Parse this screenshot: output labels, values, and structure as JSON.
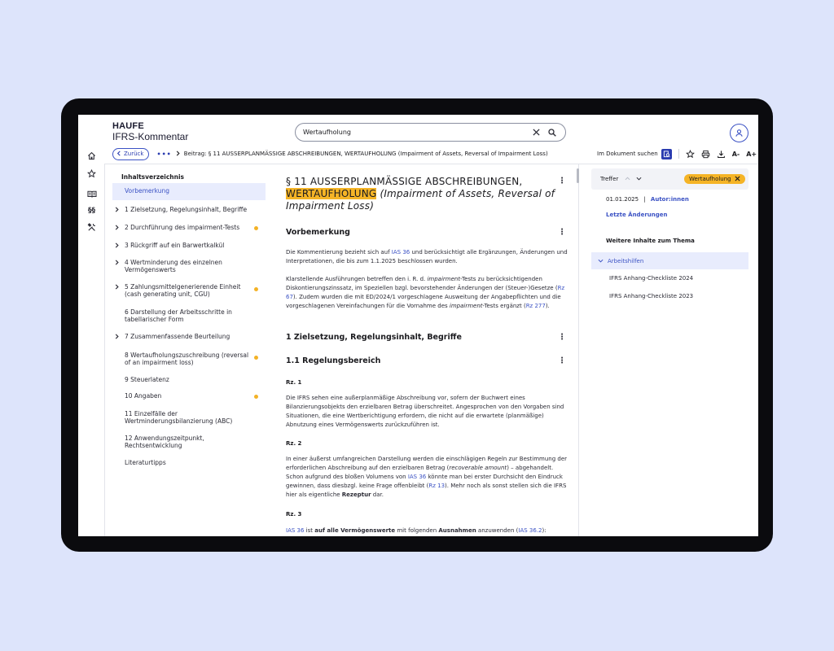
{
  "brand": {
    "logo": "HAUFE",
    "product": "IFRS-Kommentar"
  },
  "search": {
    "value": "Wertaufholung",
    "placeholder": ""
  },
  "breadcrumb": {
    "back_label": "Zurück",
    "ellipsis": "•••",
    "current": "Beitrag: § 11 AUSSERPLANMÄSSIGE ABSCHREIBUNGEN, WERTAUFHOLUNG (Impairment of Assets, Reversal of Impairment Loss)"
  },
  "doc_tools": {
    "in_doc_search_label": "Im Dokument suchen",
    "font_smaller": "A-",
    "font_larger": "A+"
  },
  "toc": {
    "title": "Inhaltsverzeichnis",
    "items": [
      {
        "label": "Vorbemerkung",
        "active": true,
        "expandable": false,
        "dot": false
      },
      {
        "label": "1 Zielsetzung, Regelungsinhalt, Begriffe",
        "active": false,
        "expandable": true,
        "dot": false
      },
      {
        "label": "2 Durchführung des impairment-Tests",
        "active": false,
        "expandable": true,
        "dot": true
      },
      {
        "label": "3 Rückgriff auf ein Barwertkalkül",
        "active": false,
        "expandable": true,
        "dot": false
      },
      {
        "label": "4 Wertminderung des einzelnen Vermögenswerts",
        "active": false,
        "expandable": true,
        "dot": false
      },
      {
        "label": "5 Zahlungsmittelgenerierende Einheit (cash generating unit, CGU)",
        "active": false,
        "expandable": true,
        "dot": true
      },
      {
        "label": "6 Darstellung der Arbeitsschritte in tabellarischer Form",
        "active": false,
        "expandable": false,
        "dot": false
      },
      {
        "label": "7 Zusammenfassende Beurteilung",
        "active": false,
        "expandable": true,
        "dot": false
      },
      {
        "label": "8 Wertaufholungszuschreibung (reversal of an impairment loss)",
        "active": false,
        "expandable": false,
        "dot": true
      },
      {
        "label": "9 Steuerlatenz",
        "active": false,
        "expandable": false,
        "dot": false
      },
      {
        "label": "10 Angaben",
        "active": false,
        "expandable": false,
        "dot": true
      },
      {
        "label": "11 Einzelfälle der Wertminderungsbilanzierung (ABC)",
        "active": false,
        "expandable": false,
        "dot": false
      },
      {
        "label": "12 Anwendungszeitpunkt, Rechtsentwicklung",
        "active": false,
        "expandable": false,
        "dot": false
      },
      {
        "label": "Literaturtipps",
        "active": false,
        "expandable": false,
        "dot": false
      }
    ]
  },
  "article": {
    "title_part1": "§ 11 AUSSERPLANMÄSSIGE ABSCHREIBUNGEN,",
    "title_highlight": "WERTAUFHOLUNG",
    "title_italic": "(Impairment of Assets, Reversal of Impairment Loss)",
    "section_vorbemerkung": "Vorbemerkung",
    "vb_p1_a": "Die Kommentierung bezieht sich auf ",
    "vb_p1_link": "IAS 36",
    "vb_p1_b": " und berücksichtigt alle Ergänzungen, Änderungen und Interpretationen, die bis zum 1.1.2025 beschlossen wurden.",
    "vb_p2_a": "Klarstellende Ausführungen betreffen den i. R. d. ",
    "vb_p2_i1": "impairment",
    "vb_p2_b": "-Tests zu berücksichtigenden Diskontierungszinssatz, im Speziellen bzgl. bevorstehender Änderungen der (Steuer-)Gesetze (",
    "vb_p2_link1": "Rz 67",
    "vb_p2_c": "). Zudem wurden die mit ED/2024/1 vorgeschlagene Ausweitung der Angabepflichten und die vorgeschlagenen Vereinfachungen für die Vornahme des ",
    "vb_p2_i2": "impairment",
    "vb_p2_d": "-Tests ergänzt (",
    "vb_p2_link2": "Rz 277",
    "vb_p2_e": ").",
    "section_1": "1 Zielsetzung, Regelungsinhalt, Begriffe",
    "section_1_1": "1.1 Regelungsbereich",
    "rz1": "Rz. 1",
    "rz1_text": "Die IFRS sehen eine außerplanmäßige Abschreibung vor, sofern der Buchwert eines Bilanzierungsobjekts den erzielbaren Betrag überschreitet. Angesprochen von den Vorgaben sind Situationen, die eine Wertberichtigung erfordern, die nicht auf die erwartete (planmäßige) Abnutzung eines Vermögenswerts zurückzuführen ist.",
    "rz2": "Rz. 2",
    "rz2_a": "In einer äußerst umfangreichen Darstellung werden die einschlägigen Regeln zur Bestimmung der erforderlichen Abschreibung auf den erzielbaren Betrag (",
    "rz2_i": "recoverable amount",
    "rz2_b": ") – abgehandelt. Schon aufgrund des bloßen Volumens von ",
    "rz2_link1": "IAS 36",
    "rz2_c": " könnte man bei erster Durchsicht den Eindruck gewinnen, dass diesbzgl. keine Frage offenbleibt (",
    "rz2_link2": "Rz 13",
    "rz2_d": "). Mehr noch als sonst stellen sich die IFRS hier als eigentliche ",
    "rz2_bold": "Rezeptur",
    "rz2_e": " dar.",
    "rz3": "Rz. 3",
    "rz3_link1": "IAS 36",
    "rz3_a": " ist ",
    "rz3_bold1": "auf alle Vermögenswerte",
    "rz3_b": " mit folgenden ",
    "rz3_bold2": "Ausnahmen",
    "rz3_c": " anzuwenden (",
    "rz3_link2": "IAS 36.2",
    "rz3_d": "):"
  },
  "panel": {
    "treffer_label": "Treffer",
    "chip_label": "Wertaufholung",
    "date": "01.01.2025",
    "date_sep": "|",
    "authors_link": "Autor:innen",
    "last_changes": "Letzte Änderungen",
    "more_title": "Weitere Inhalte zum Thema",
    "group_label": "Arbeitshilfen",
    "group_items": [
      "IFRS Anhang-Checkliste 2024",
      "IFRS Anhang-Checkliste 2023"
    ]
  },
  "colors": {
    "accent": "#3b52c4",
    "highlight": "#f5b426",
    "background": "#dde4fb",
    "device": "#0b0b0e"
  }
}
